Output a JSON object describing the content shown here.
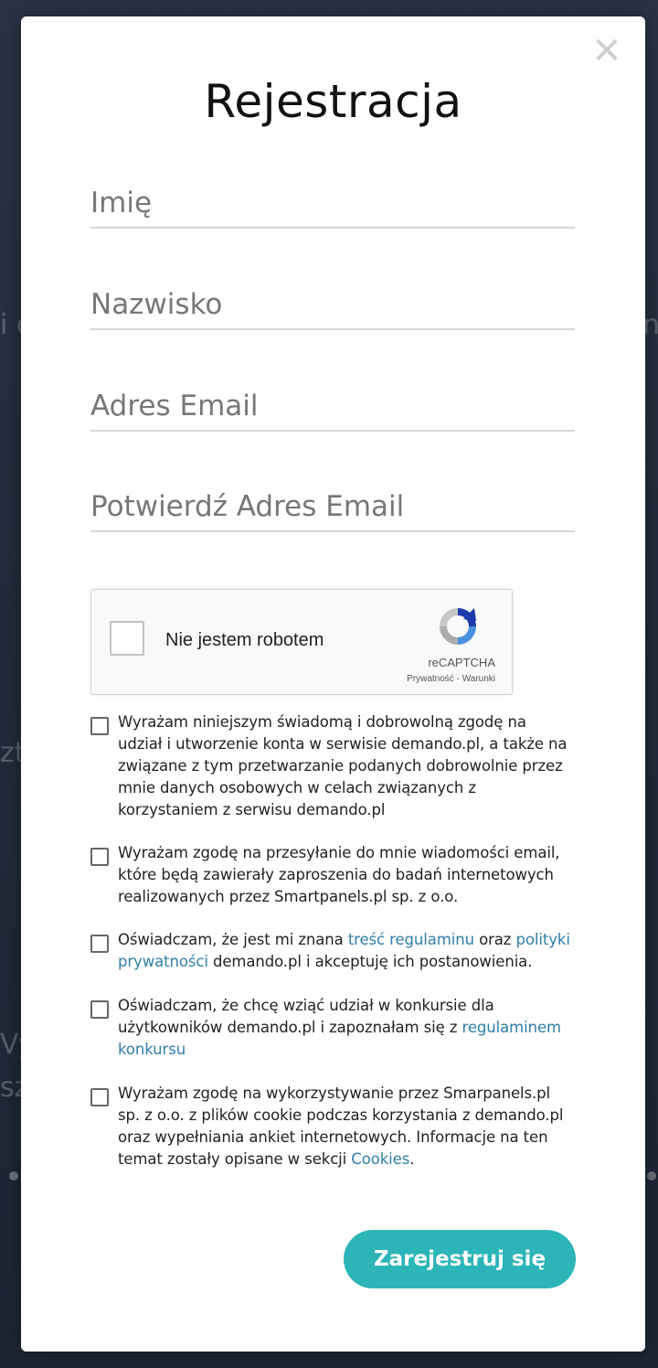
{
  "modal": {
    "title": "Rejestracja",
    "close_icon": "close-icon"
  },
  "fields": {
    "first_name_placeholder": "Imię",
    "last_name_placeholder": "Nazwisko",
    "email_placeholder": "Adres Email",
    "email_confirm_placeholder": "Potwierdź Adres Email"
  },
  "captcha": {
    "label": "Nie jestem robotem",
    "brand": "reCAPTCHA",
    "privacy": "Prywatność",
    "separator": " - ",
    "terms": "Warunki",
    "logo_icon": "recaptcha-logo-icon"
  },
  "consents": {
    "c1": "Wyrażam niniejszym świadomą i dobrowolną zgodę na udział i utworzenie konta w serwisie demando.pl, a także na związane z tym przetwarzanie podanych dobrowolnie przez mnie danych osobowych w celach związanych z korzystaniem z serwisu demando.pl",
    "c2": "Wyrażam zgodę na przesyłanie do mnie wiadomości email, które będą zawierały zaproszenia do badań internetowych realizowanych przez Smartpanels.pl sp. z o.o.",
    "c3_before": "Oświadczam, że jest mi znana ",
    "c3_link1": "treść regulaminu",
    "c3_mid": " oraz ",
    "c3_link2": "polityki prywatności",
    "c3_after": " demando.pl i akceptuję ich postanowienia.",
    "c4_before": "Oświadczam, że chcę wziąć udział w konkursie dla użytkowników demando.pl i zapoznałam się z ",
    "c4_link": "regulaminem konkursu",
    "c5_before": "Wyrażam zgodę na wykorzystywanie przez Smarpanels.pl sp. z o.o. z plików cookie podczas korzystania z demando.pl oraz wypełniania ankiet internetowych. Informacje na ten temat zostały opisane w sekcji ",
    "c5_link": "Cookies",
    "c5_after": "."
  },
  "submit": {
    "label": "Zarejestruj się"
  },
  "colors": {
    "accent": "#2cb5b8",
    "link": "#2f7fa8"
  }
}
